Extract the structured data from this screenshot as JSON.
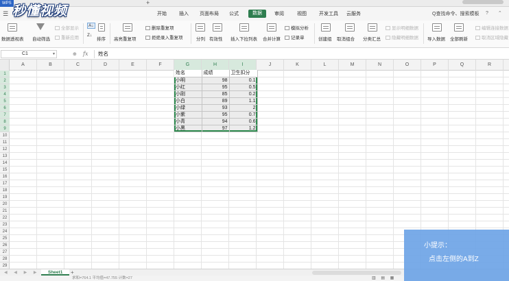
{
  "app": {
    "badge": "WPS",
    "watermark": "秒懂视频",
    "new_tab": "+"
  },
  "menu": {
    "tabs": [
      "开始",
      "插入",
      "页面布局",
      "公式",
      "数据",
      "审阅",
      "视图",
      "开发工具",
      "云服务"
    ],
    "active_tab": "数据",
    "search": "Q查找命令、搜索模板",
    "help": "? ⌃"
  },
  "toolbar": {
    "pivot": "数据透视表",
    "auto_filter": "自动筛选",
    "show_all": "全部显示",
    "reapply": "重新应用",
    "sort_az": "A↓",
    "sort_za": "Z↓",
    "sort": "排序",
    "highlight_dup": "高亮重复项",
    "remove_dup": "删除重复项",
    "reject_dup": "拒绝录入重复项",
    "text_to_col": "分列",
    "validity": "有效性",
    "insert_dropdown": "插入下拉列表",
    "consolidate": "合并计算",
    "what_if": "模拟分析",
    "record_form": "记录单",
    "group": "创建组",
    "ungroup": "取消组合",
    "subtotal": "分类汇总",
    "show_detail": "显示明细数据",
    "hide_detail": "隐藏明细数据",
    "import_data": "导入数据",
    "refresh_all": "全部刷新",
    "edit_links": "编辑连接数据",
    "clear_area": "取消区域隐藏"
  },
  "formula_bar": {
    "name_box": "C1",
    "fx": "fx",
    "value": "姓名"
  },
  "grid": {
    "columns": [
      "A",
      "B",
      "C",
      "D",
      "E",
      "F",
      "G",
      "H",
      "I",
      "J",
      "K",
      "L",
      "M",
      "N",
      "O",
      "P",
      "Q",
      "R"
    ],
    "selected_columns": [
      "G",
      "H",
      "I"
    ],
    "rows": [
      "1",
      "2",
      "3",
      "4",
      "5",
      "6",
      "7",
      "8",
      "9",
      "10",
      "11",
      "12",
      "13",
      "14",
      "15",
      "16",
      "17",
      "18",
      "19",
      "20",
      "21",
      "22",
      "23",
      "24",
      "25",
      "26",
      "27",
      "28",
      "29"
    ],
    "selected_rows": [
      "1",
      "2",
      "3",
      "4",
      "5",
      "6",
      "7",
      "8",
      "9"
    ],
    "table": {
      "headers": [
        "姓名",
        "成绩",
        "卫生扣分"
      ],
      "rows": [
        [
          "小明",
          "98",
          "0.1"
        ],
        [
          "小红",
          "95",
          "0.5"
        ],
        [
          "小刚",
          "85",
          "0.2"
        ],
        [
          "小白",
          "89",
          "1.1"
        ],
        [
          "小绿",
          "93",
          "2"
        ],
        [
          "小紫",
          "95",
          "0.7"
        ],
        [
          "小青",
          "94",
          "0.6"
        ],
        [
          "小黑",
          "97",
          "1.2"
        ]
      ]
    }
  },
  "sheets": {
    "tabs": [
      "Sheet1"
    ],
    "nav": "◀ ◀ ▶ ▶",
    "add": "+"
  },
  "status": {
    "text": "求和=764.1  平均值=47.755  计数=27",
    "views": "▥ ▤ ▦"
  },
  "tip": {
    "title": "小提示：",
    "body": "点击左侧的A到Z"
  },
  "colors": {
    "accent_green": "#2e7d4f",
    "tip_blue": "#6ea4e6",
    "selection_fill": "#ececec"
  }
}
